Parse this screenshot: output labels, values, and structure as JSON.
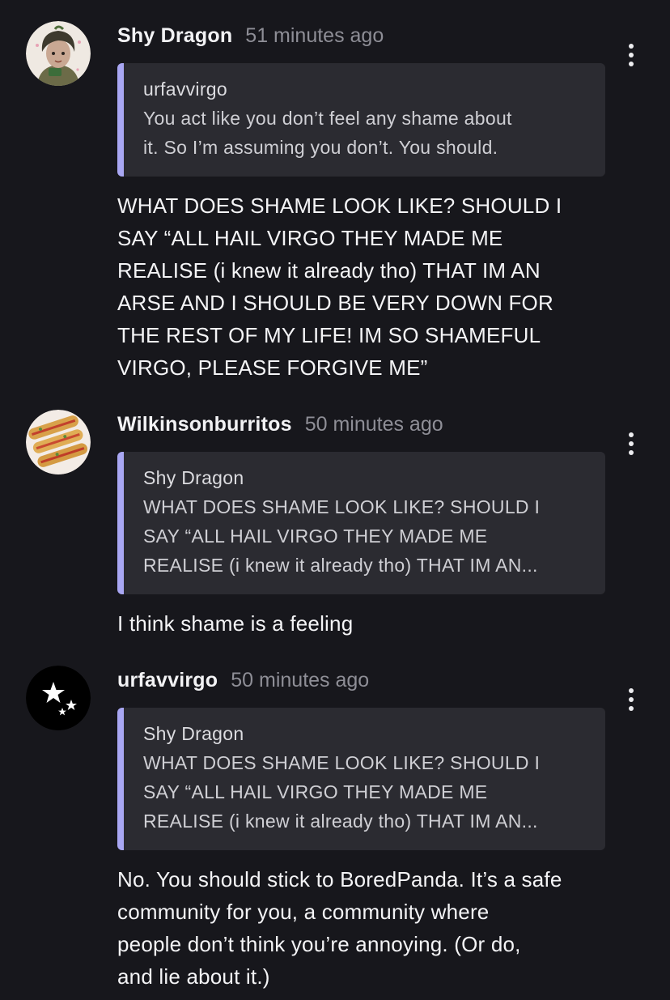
{
  "comments": [
    {
      "author": "Shy Dragon",
      "time": "51 minutes ago",
      "avatar": "dragon-avatar",
      "quote": {
        "author": "urfavvirgo",
        "lines": [
          "You act like you don’t feel any shame about",
          "it. So I’m assuming you don’t. You should."
        ]
      },
      "body_lines": [
        "WHAT DOES SHAME LOOK LIKE? SHOULD I",
        "SAY “ALL HAIL VIRGO THEY MADE ME",
        "REALISE (i knew it already tho) THAT IM AN",
        "ARSE AND I SHOULD BE VERY DOWN FOR",
        "THE REST OF MY LIFE! IM SO SHAMEFUL",
        "VIRGO, PLEASE FORGIVE ME”"
      ]
    },
    {
      "author": "Wilkinsonburritos",
      "time": "50 minutes ago",
      "avatar": "burrito-avatar",
      "quote": {
        "author": "Shy Dragon",
        "lines": [
          "WHAT DOES SHAME LOOK LIKE? SHOULD I",
          "SAY “ALL HAIL VIRGO THEY MADE ME",
          "REALISE (i knew it already tho) THAT IM AN..."
        ]
      },
      "body_lines": [
        "I think shame is a feeling"
      ]
    },
    {
      "author": "urfavvirgo",
      "time": "50 minutes ago",
      "avatar": "stars-avatar",
      "quote": {
        "author": "Shy Dragon",
        "lines": [
          "WHAT DOES SHAME LOOK LIKE? SHOULD I",
          "SAY “ALL HAIL VIRGO THEY MADE ME",
          "REALISE (i knew it already tho) THAT IM AN..."
        ]
      },
      "body_lines": [
        "No. You should stick to BoredPanda. It’s a safe",
        "community for you, a community where",
        "people don’t think you’re annoying. (Or do,",
        "and lie about it.)"
      ]
    }
  ],
  "colors": {
    "background": "#17171c",
    "quote_background": "#2b2b31",
    "quote_accent": "#a9a7f3",
    "timestamp": "#8e8e96"
  }
}
